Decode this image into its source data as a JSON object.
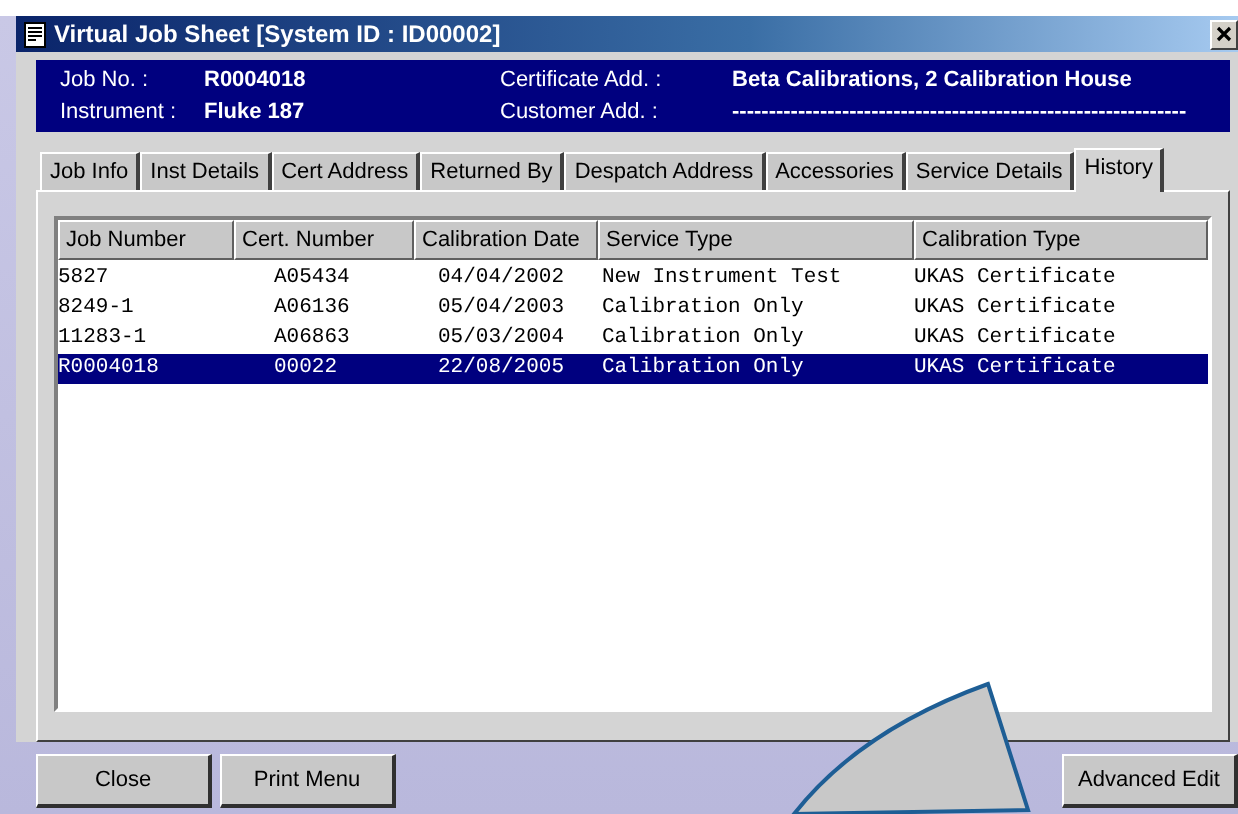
{
  "window": {
    "title": "Virtual Job Sheet [System ID : ID00002]"
  },
  "header": {
    "fields": [
      {
        "label": "Job No. :",
        "value": "R0004018"
      },
      {
        "label": "Certificate Add. :",
        "value": "Beta Calibrations, 2 Calibration House"
      },
      {
        "label": "Instrument :",
        "value": "Fluke 187"
      },
      {
        "label": "Customer  Add. :",
        "value": "--------------------------------------------------------------"
      }
    ]
  },
  "tabs": [
    {
      "label": "Job Info",
      "selected": false
    },
    {
      "label": "Inst Details",
      "selected": false
    },
    {
      "label": "Cert Address",
      "selected": false
    },
    {
      "label": "Returned By",
      "selected": false
    },
    {
      "label": "Despatch Address",
      "selected": false
    },
    {
      "label": "Accessories",
      "selected": false
    },
    {
      "label": "Service Details",
      "selected": false
    },
    {
      "label": "History",
      "selected": true
    }
  ],
  "table": {
    "columns": [
      "Job Number",
      "Cert. Number",
      "Calibration Date",
      "Service Type",
      "Calibration Type"
    ],
    "rows": [
      {
        "cells": [
          "5827",
          "A05434",
          "04/04/2002",
          "New Instrument Test",
          "UKAS Certificate"
        ],
        "selected": false
      },
      {
        "cells": [
          "8249-1",
          "A06136",
          "05/04/2003",
          "Calibration Only",
          "UKAS Certificate"
        ],
        "selected": false
      },
      {
        "cells": [
          "11283-1",
          "A06863",
          "05/03/2004",
          "Calibration Only",
          "UKAS Certificate"
        ],
        "selected": false
      },
      {
        "cells": [
          "R0004018",
          "00022",
          "22/08/2005",
          "Calibration Only",
          "UKAS Certificate"
        ],
        "selected": true
      }
    ]
  },
  "buttons": {
    "left": [
      "Close",
      "Print Menu"
    ],
    "right": [
      "Advanced Edit"
    ]
  }
}
